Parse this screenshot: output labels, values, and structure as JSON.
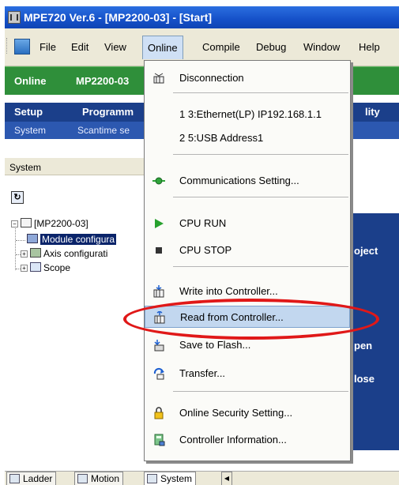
{
  "window": {
    "title": "MPE720 Ver.6 - [MP2200-03] - [Start]"
  },
  "menubar": {
    "items": [
      {
        "label": "File"
      },
      {
        "label": "Edit"
      },
      {
        "label": "View"
      },
      {
        "label": "Online"
      },
      {
        "label": "Compile"
      },
      {
        "label": "Debug"
      },
      {
        "label": "Window"
      },
      {
        "label": "Help"
      }
    ]
  },
  "status_strip": {
    "status": "Online",
    "controller": "MP2200-03"
  },
  "tabs": {
    "main": [
      "Setup",
      "Programm",
      "lity"
    ],
    "sub": [
      "System",
      "Scantime se"
    ]
  },
  "left_panel": {
    "header": "System",
    "tree": [
      {
        "label": "[MP2200-03]"
      },
      {
        "label": "Module configura"
      },
      {
        "label": "Axis configurati"
      },
      {
        "label": "Scope"
      }
    ]
  },
  "right_panel": {
    "items": [
      "oject",
      "pen",
      "lose"
    ]
  },
  "online_menu": {
    "items": [
      {
        "label": "Disconnection",
        "icon": "disconnect-icon"
      },
      {
        "label": "1 3:Ethernet(LP) IP192.168.1.1",
        "icon": ""
      },
      {
        "label": "2 5:USB Address1",
        "icon": ""
      },
      {
        "label": "Communications Setting...",
        "icon": "communications-icon"
      },
      {
        "label": "CPU RUN",
        "icon": "play-icon"
      },
      {
        "label": "CPU STOP",
        "icon": "stop-icon"
      },
      {
        "label": "Write into Controller...",
        "icon": "write-controller-icon"
      },
      {
        "label": "Read from Controller...",
        "icon": "read-controller-icon",
        "highlighted": true
      },
      {
        "label": "Save to Flash...",
        "icon": "save-flash-icon"
      },
      {
        "label": "Transfer...",
        "icon": "transfer-icon"
      },
      {
        "label": "Online Security Setting...",
        "icon": "lock-icon"
      },
      {
        "label": "Controller Information...",
        "icon": "controller-info-icon"
      }
    ]
  },
  "bottom_tabs": [
    "Ladder",
    "Motion",
    "System"
  ],
  "colors": {
    "titlebar": "#1550c8",
    "online_status": "#2f8f3a",
    "tab_bar": "#1b3f8a",
    "menu_highlight": "#c2d7ef",
    "annotation_ellipse": "#e01818"
  }
}
